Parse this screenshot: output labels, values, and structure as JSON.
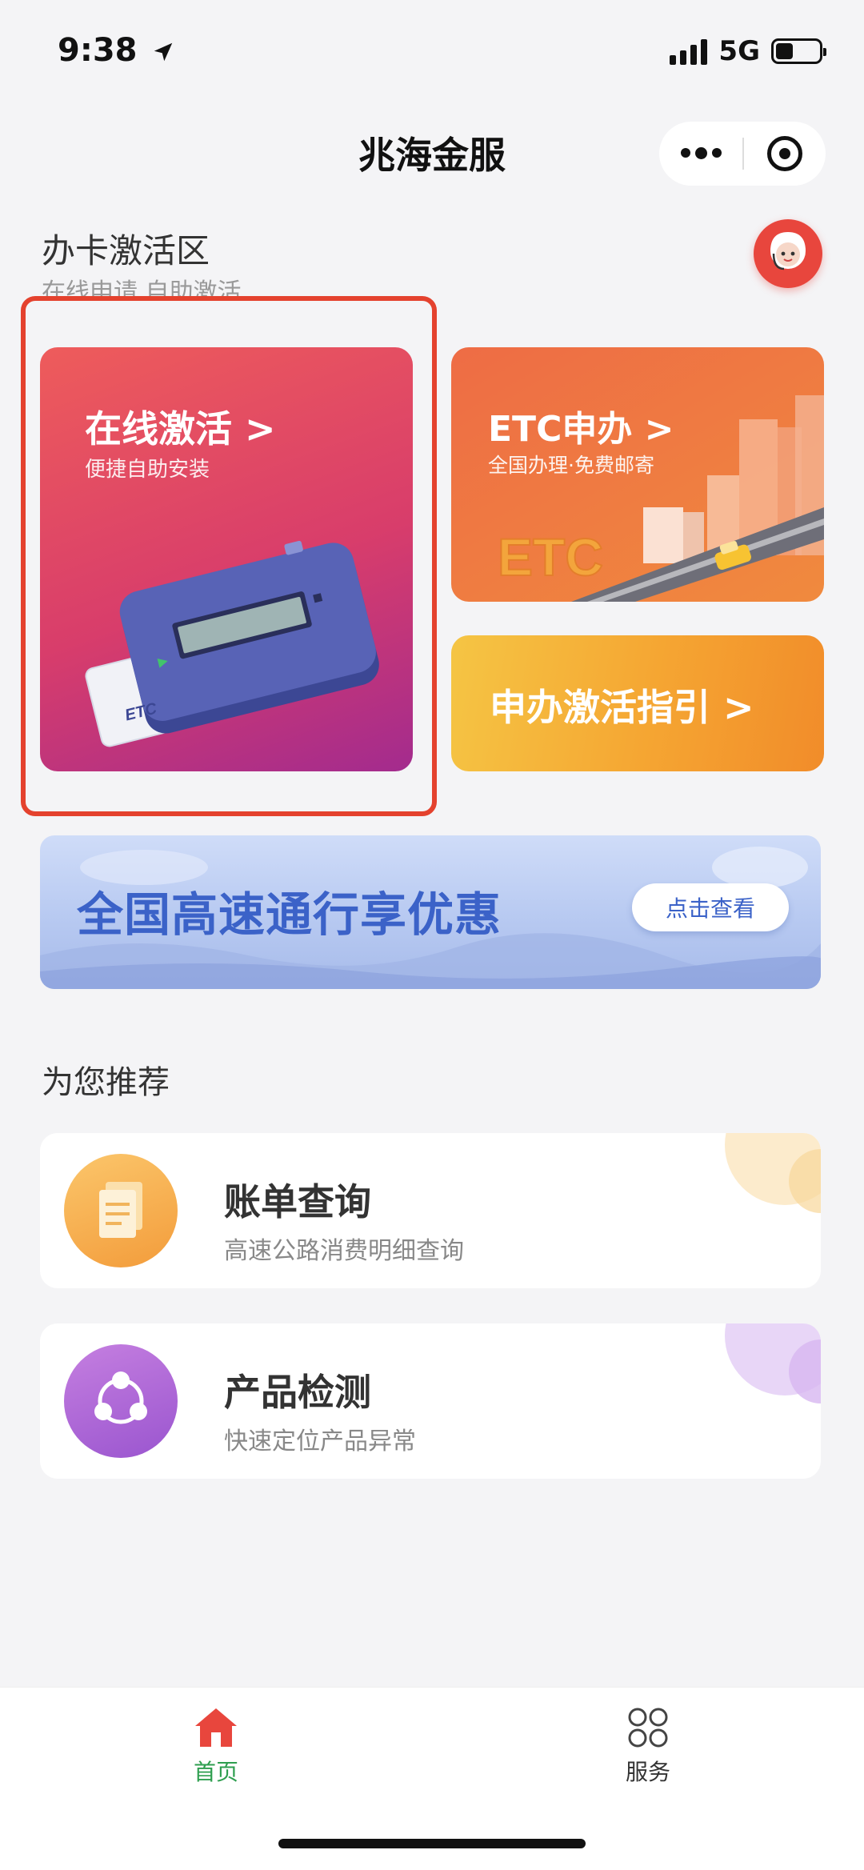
{
  "status_bar": {
    "time": "9:38",
    "network": "5G",
    "battery_level": 0.4
  },
  "nav": {
    "title": "兆海金服",
    "more_icon": "more-dots-icon",
    "close_icon": "close-target-icon"
  },
  "section": {
    "title": "办卡激活区",
    "subtitle": "在线申请 自助激活"
  },
  "cards": {
    "activate": {
      "title": "在线激活 >",
      "subtitle": "便捷自助安装",
      "card_text": "ETC"
    },
    "etc_apply": {
      "title": "ETC申办 >",
      "subtitle": "全国办理·免费邮寄",
      "sign_text": "ETC"
    },
    "guide": {
      "title": "申办激活指引 >"
    }
  },
  "banner": {
    "title": "全国高速通行享优惠",
    "button": "点击查看"
  },
  "recommend": {
    "title": "为您推荐",
    "items": [
      {
        "title": "账单查询",
        "subtitle": "高速公路消费明细查询",
        "icon": "bill-document-icon"
      },
      {
        "title": "产品检测",
        "subtitle": "快速定位产品异常",
        "icon": "detect-share-icon"
      }
    ]
  },
  "tabbar": {
    "items": [
      {
        "label": "首页",
        "icon": "home-icon",
        "active": true
      },
      {
        "label": "服务",
        "icon": "grid-service-icon",
        "active": false
      }
    ],
    "active_color": "#2e9e4f"
  }
}
